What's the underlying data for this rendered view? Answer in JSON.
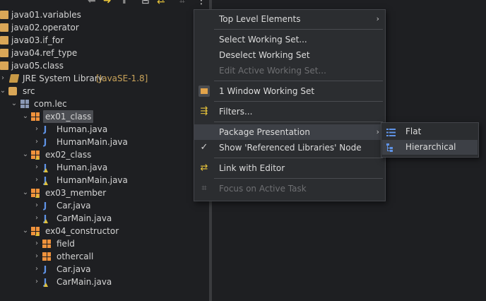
{
  "tree": {
    "projects": [
      "java01.variables",
      "java02.operator",
      "java03.if_for",
      "java04.ref_type",
      "java05.class"
    ],
    "library": {
      "label": "JRE System Library",
      "decoration": "[JavaSE-1.8]"
    },
    "src": "src",
    "root_package": "com.lec",
    "packages": [
      {
        "name": "ex01_class",
        "files": [
          "Human.java",
          "HumanMain.java"
        ]
      },
      {
        "name": "ex02_class",
        "files": [
          "Human.java",
          "HumanMain.java"
        ]
      },
      {
        "name": "ex03_member",
        "files": [
          "Car.java",
          "CarMain.java"
        ]
      },
      {
        "name": "ex04_constructor",
        "subpackages": [
          "field",
          "othercall"
        ],
        "files": [
          "Car.java",
          "CarMain.java"
        ]
      }
    ]
  },
  "menu": {
    "top_level": "Top Level Elements",
    "select_ws": "Select Working Set...",
    "deselect_ws": "Deselect Working Set",
    "edit_ws": "Edit Active Working Set...",
    "window_ws": "1 Window Working Set",
    "filters": "Filters...",
    "package_presentation": "Package Presentation",
    "show_ref_libs": "Show 'Referenced Libraries' Node",
    "link_editor": "Link with Editor",
    "focus_task": "Focus on Active Task"
  },
  "submenu": {
    "flat": "Flat",
    "hierarchical": "Hierarchical"
  },
  "colors": {
    "accent": "#f0923c",
    "highlight": "#3d4046",
    "link": "#5f93e6"
  }
}
